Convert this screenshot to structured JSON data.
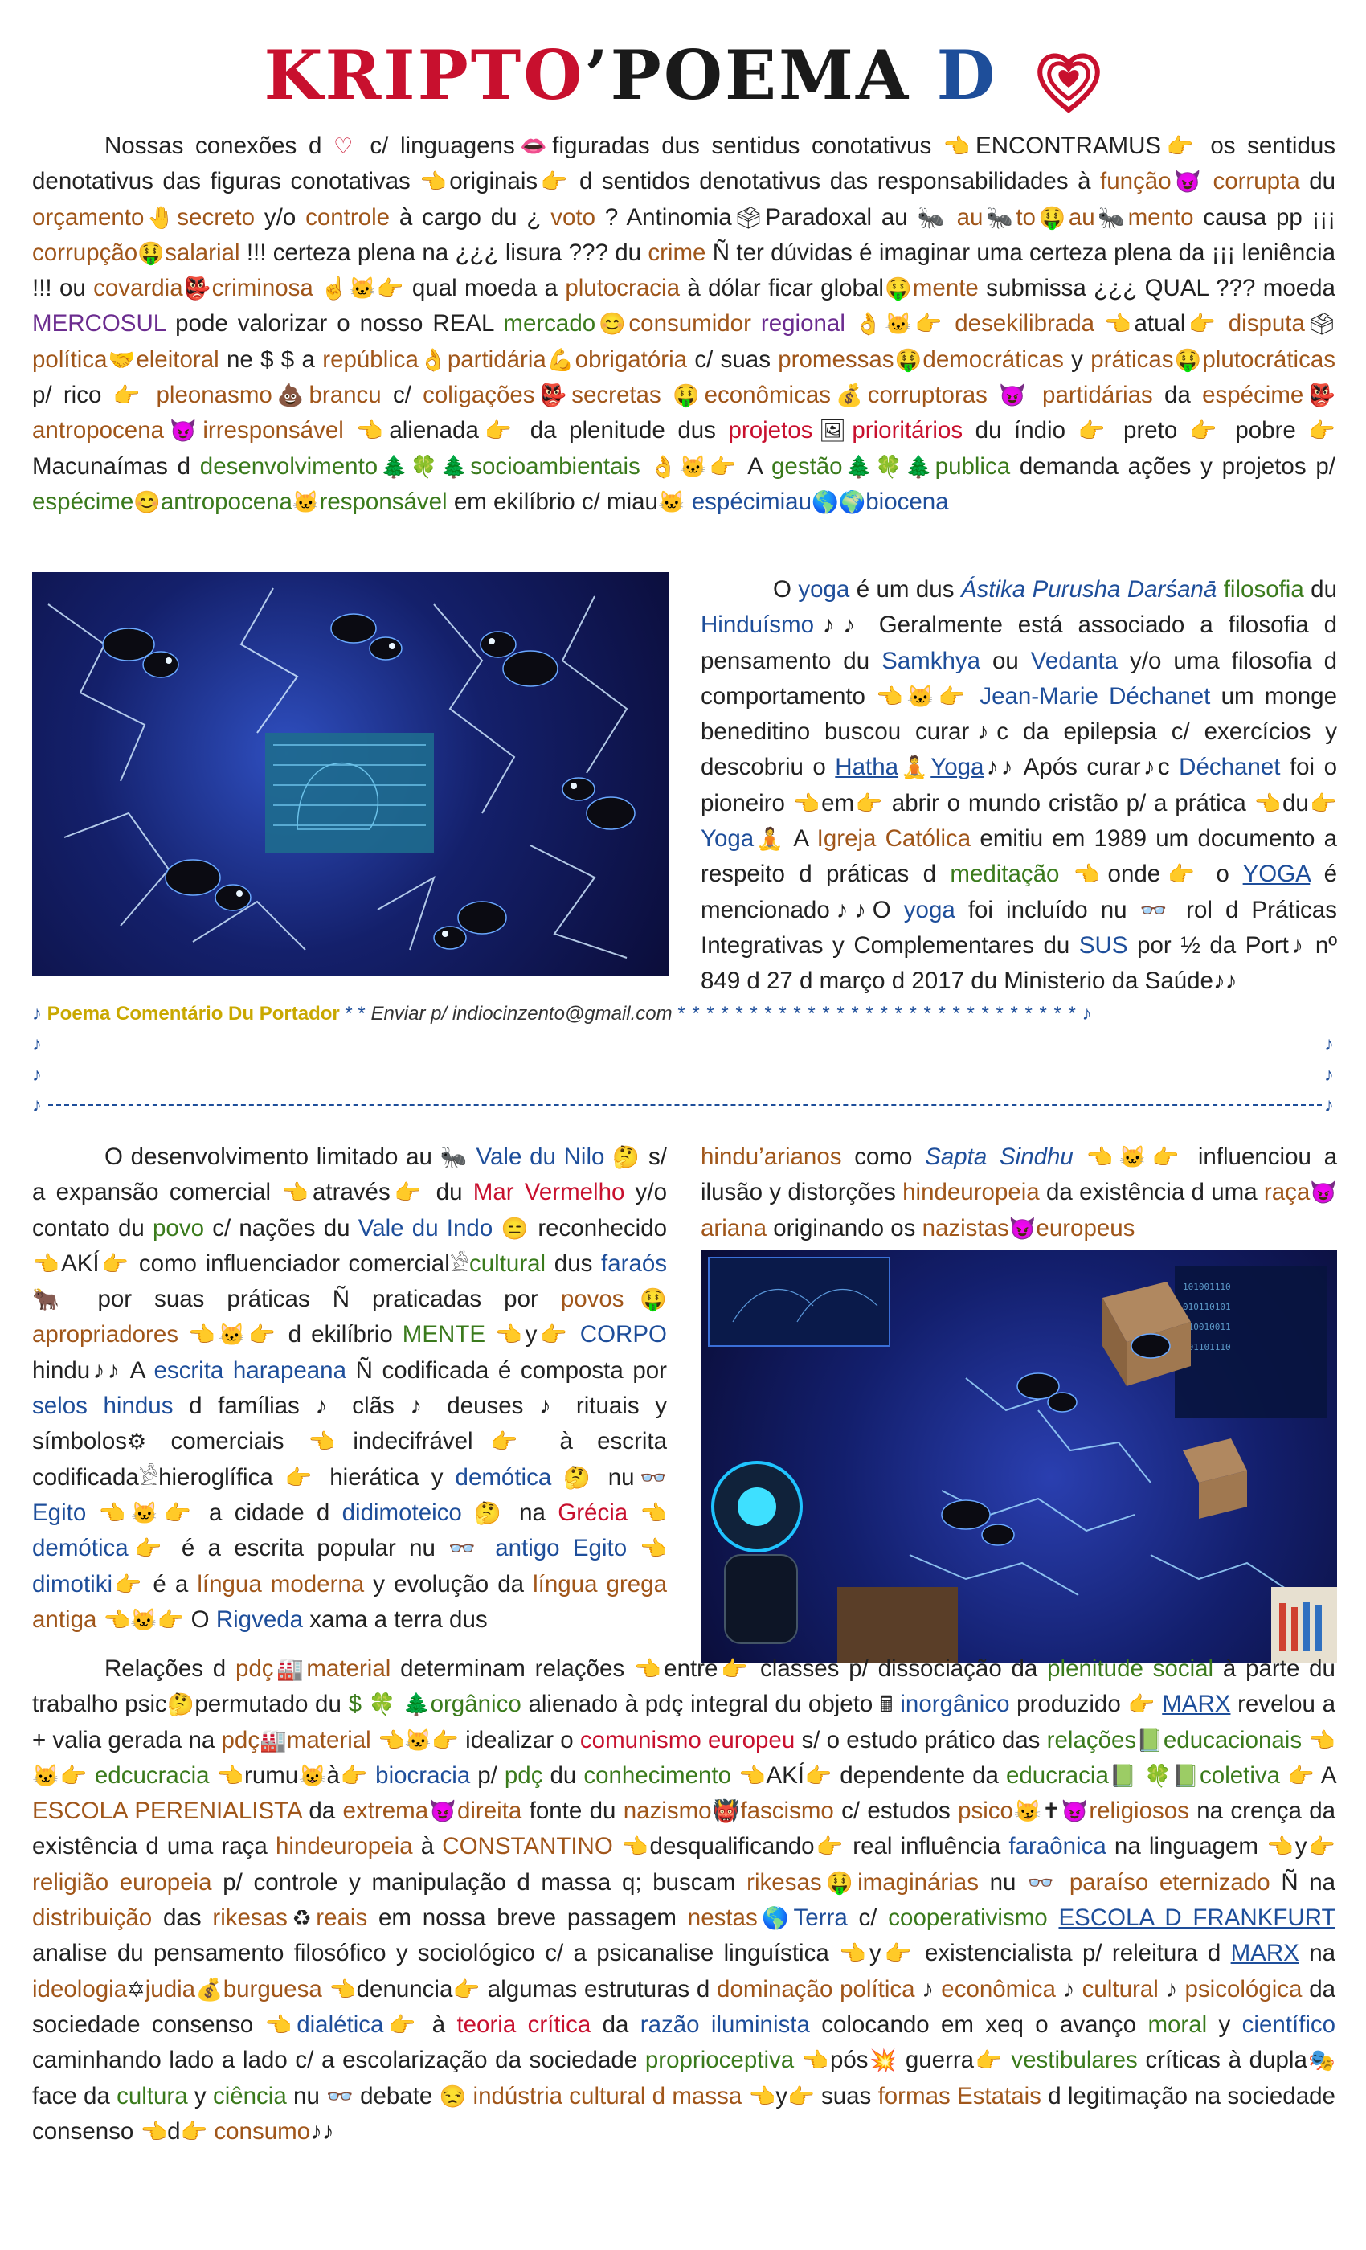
{
  "header": {
    "title_part1": "KRIPTO",
    "title_part2": "’POEMA",
    "title_part3": "D"
  },
  "icons": {
    "heart": "heart-icon",
    "point_left": "👈",
    "point_right": "👉",
    "money_bag": "💰",
    "mask": "👺"
  },
  "paragraph1": {
    "a": "Nossas conexões d",
    "b": "c/ linguagens",
    "c": "figuradas dus sentidus conotativus",
    "d": "ENCONTRAMUS",
    "e": "os sentidus denotativus das figuras conotativas",
    "f": "originais",
    "g": "d sentidos denotativus das responsabilidades à",
    "funcao": "função",
    "corrupta": "corrupta",
    "h": "du",
    "orcamento": "orçamento",
    "secreto": "secreto",
    "i": "y/o",
    "controle": "controle",
    "j": "à cargo du ¿",
    "voto": "voto",
    "k": "? Antinomia",
    "l": "Paradoxal au",
    "au": "au",
    "to": "to",
    "au2": "au",
    "mento": "mento",
    "m": "causa pp ¡¡¡",
    "corrupcao": "corrupção",
    "salarial": "salarial",
    "n": "!!! certeza plena na ¿¿¿ lisura ??? du",
    "crime": "crime",
    "o": "Ñ ter dúvidas é imaginar uma certeza plena da ¡¡¡ leniência !!! ou",
    "covardia": "covardia",
    "criminosa": "criminosa",
    "p": "qual moeda a",
    "plutocracia": "plutocracia",
    "q": "à dólar ficar global",
    "mente": "mente",
    "r": "submissa ¿¿¿ QUAL ??? moeda",
    "mercosul": "MERCOSUL",
    "s": "pode valorizar o nosso REAL",
    "mercado": "mercado",
    "consumidor": "consumidor",
    "regional": "regional",
    "desekilibrada": "desekilibrada",
    "t": "atual",
    "disputa": "disputa",
    "politica": "política",
    "eleitoral": "eleitoral",
    "u": "ne $ $ a",
    "republica": "república",
    "partidaria": "partidária",
    "obrigatoria": "obrigatória",
    "v": "c/ suas",
    "promessas": "promessas",
    "democraticas": "democráticas",
    "x": "y",
    "praticas": "práticas",
    "plutocraticas": "plutocráticas",
    "y": "p/ rico",
    "pleonasmo": "pleonasmo",
    "brancu": "brancu",
    "z": "c/",
    "coligacoes": "coligações",
    "secretas": "secretas",
    "economicas": "econômicas",
    "corruptoras": "corruptoras",
    "partidarias": "partidárias",
    "aa": "da",
    "especime": "espécime",
    "antropocena": "antropocena",
    "irresponsavel": "irresponsável",
    "bb": "alienada",
    "cc": "da plenitude dus",
    "projetos": "projetos",
    "prioritarios": "prioritários",
    "dd": "du índio",
    "ee": "preto",
    "ff": "pobre",
    "gg": "Macunaímas d",
    "desenvolvimento": "desenvolvimento",
    "socioambientais": "socioambientais",
    "hh": "A",
    "gestao": "gestão",
    "publica": "publica",
    "ii": "demanda ações y projetos p/",
    "especime2": "espécime",
    "antropocena2": "antropocena",
    "responsavel": "responsável",
    "jj": "em ekilíbrio c/ miau",
    "especimiau": "espécimiau",
    "biocena": "biocena"
  },
  "paragraph2": {
    "a": "O",
    "yoga": "yoga",
    "b": "é um dus",
    "astika": "Ástika Purusha Darśanā",
    "filosofia": "filosofia",
    "c": "du",
    "hinduismo": "Hinduísmo",
    "d": "Geralmente está associado a filosofia d pensamento du",
    "samkhya": "Samkhya",
    "e": "ou",
    "vedanta": "Vedanta",
    "f": "y/o uma filosofia d comportamento",
    "jean": "Jean-Marie Déchanet",
    "g": "um monge beneditino buscou curar♪c da epilepsia c/ exercícios y descobriu o",
    "hatha": "Hatha",
    "yoga2": "Yoga",
    "h": "Após curar♪c",
    "dechanet": "Déchanet",
    "i": "foi o pioneiro",
    "j": "em",
    "k": "abrir o mundo cristão p/ a prática",
    "l": "du",
    "yoga3": "Yoga",
    "m": "A",
    "igreja": "Igreja Católica",
    "n": "emitiu em 1989 um documento a respeito d práticas d",
    "meditacao": "meditação",
    "o": "onde",
    "p": "o",
    "yoga4": "YOGA",
    "q": "é mencionado",
    "r": "O",
    "yoga5": "yoga",
    "s": "foi incluído nu",
    "t": "rol d Práticas Integrativas y Complementares du",
    "sus": "SUS",
    "u": "por ½ da Port♪ nº 849 d 27 d março d 2017 du Ministerio da Saúde"
  },
  "comment": {
    "title": "Poema Comentário Du Portador",
    "stars1": "* *",
    "send_label": "Enviar p/",
    "email": "indiocinzento@gmail.com",
    "stars2": "* * * * * * * * * * * * * * * * * * * * * * * * * * * *",
    "note": "♪"
  },
  "paragraph3": {
    "a": "O desenvolvimento limitado au",
    "vale_nilo": "Vale du Nilo",
    "b": "s/ a expansão comercial",
    "c": "através",
    "d": "du",
    "mar": "Mar Vermelho",
    "e": "y/o contato du",
    "povo": "povo",
    "f": "c/ nações du",
    "vale_indo": "Vale du Indo",
    "g": "reconhecido",
    "h": "AKÍ",
    "i": "como influenciador comercial",
    "cultural": "cultural",
    "j": "dus",
    "faraos": "faraós",
    "k": "por suas práticas Ñ praticadas por",
    "povos": "povos",
    "apropriadores": "apropriadores",
    "l": "d ekilíbrio",
    "mente": "MENTE",
    "m": "y",
    "corpo": "CORPO",
    "n": "hindu",
    "o": "A",
    "escrita": "escrita harapeana",
    "p": "Ñ codificada é composta por",
    "selos": "selos hindus",
    "q": "d famílias ♪ clãs ♪ deuses ♪ rituais y símbolos",
    "r": "comerciais",
    "s": "indecifrável",
    "t": "à escrita codificada",
    "u": "hieroglífica",
    "v": "hierática y",
    "demotica": "demótica",
    "x": "nu",
    "egito": "Egito",
    "y": "a cidade d",
    "didimoteico": "didimoteico",
    "z": "na",
    "grecia": "Grécia",
    "demotica2": "demótica",
    "aa": "é a escrita popular nu",
    "antigo": "antigo Egito",
    "dimotiki": "dimotiki",
    "bb": "é a",
    "lingua": "língua moderna",
    "cc": "y evolução da",
    "lingua2": "língua grega antiga",
    "dd": "O",
    "rigveda": "Rigveda",
    "ee": "xama a terra dus"
  },
  "paragraph4": {
    "hindu": "hindu’arianos",
    "a": "como",
    "sapta": "Sapta Sindhu",
    "b": "influenciou a ilusão y distorções",
    "hindeuropeia": "hindeuropeia",
    "c": "da existência d uma",
    "raca": "raça",
    "ariana": "ariana",
    "d": "originando os",
    "nazistas": "nazistas",
    "europeus": "europeus"
  },
  "paragraph5": {
    "a": "Relações d",
    "pdc": "pdç",
    "material": "material",
    "b": "determinam relações",
    "c": "entre",
    "d": "classes p/ dissociação da",
    "plenitude": "plenitude social",
    "e": "à parte du trabalho psic",
    "f": "permutado du",
    "organico": "orgânico",
    "g": "alienado à pdç integral du objeto",
    "inorganico": "inorgânico",
    "h": "produzido",
    "marx": "MARX",
    "i": "revelou a + valia gerada na",
    "pdc2": "pdç",
    "material2": "material",
    "j": "idealizar o",
    "comunismo": "comunismo europeu",
    "k": "s/ o estudo prático das",
    "relacoes": "relações",
    "educacionais": "educacionais",
    "educcracia": "edcucracia",
    "l": "rumu",
    "m": "à",
    "biocracia": "biocracia",
    "n": "p/",
    "pdc3": "pdç",
    "o": "du",
    "conhecimento": "conhecimento",
    "p": "AKÍ",
    "q": "dependente da",
    "educracia": "educracia",
    "coletiva": "coletiva",
    "r": "A",
    "escola": "ESCOLA PERENIALISTA",
    "s": "da",
    "extrema": "extrema",
    "direita": "direita",
    "t": "fonte du",
    "nazismo": "nazismo",
    "fascismo": "fascismo",
    "u": "c/ estudos",
    "psico": "psico",
    "religiosos": "religiosos",
    "v": "na crença da existência d uma raça",
    "hindeuropeia": "hindeuropeia",
    "x": "à",
    "constantino": "CONSTANTINO",
    "y": "desqualificando",
    "z": "real influência",
    "faraonica": "faraônica",
    "aa": "na linguagem",
    "bb": "y",
    "religiao": "religião europeia",
    "cc": "p/ controle y manipulação d massa q; buscam",
    "rikesas": "rikesas",
    "imaginarias": "imaginárias",
    "dd": "nu",
    "paraiso": "paraíso eternizado",
    "ee": "Ñ na",
    "distribuicao": "distribuição",
    "ff": "das",
    "rikesas2": "rikesas",
    "reais": "reais",
    "gg": "em nossa breve passagem",
    "nestas": "nestas",
    "terra": "Terra",
    "hh": "c/",
    "cooperativismo": "cooperativismo",
    "escola2": "ESCOLA D FRANKFURT",
    "ii": "analise du pensamento filosófico y sociológico c/ a psicanalise linguística",
    "jj": "y",
    "kk": "existencialista p/ releitura d",
    "marx2": "MARX",
    "ll": "na",
    "ideologia": "ideologia",
    "judia": "judia",
    "burguesa": "burguesa",
    "mm": "denuncia",
    "nn": "algumas estruturas d",
    "dominacao": "dominação política",
    "economica": "econômica",
    "cultural": "cultural",
    "psicologica": "psicológica",
    "oo": "da sociedade consenso",
    "dialetica": "dialética",
    "pp": "à",
    "teoria": "teoria crítica",
    "qq": "da",
    "razao": "razão iluminista",
    "rr": "colocando em xeq o avanço",
    "moral": "moral",
    "ss": "y",
    "cientifico": "científico",
    "tt": "caminhando lado a lado c/ a escolarização da sociedade",
    "proprio": "proprioceptiva",
    "uu": "pós",
    "vv": "guerra",
    "vestibulares": "vestibulares",
    "ww": "críticas à dupla",
    "xx": "face da",
    "cultura": "cultura",
    "yy": "y",
    "ciencia": "ciência",
    "zz": "nu",
    "aaa": "debate",
    "industria": "indústria cultural d massa",
    "bbb": "y",
    "ccc": "suas",
    "formas": "formas Estatais",
    "ddd": "d legitimação na sociedade consenso",
    "eee": "d",
    "consumo": "consumo"
  }
}
